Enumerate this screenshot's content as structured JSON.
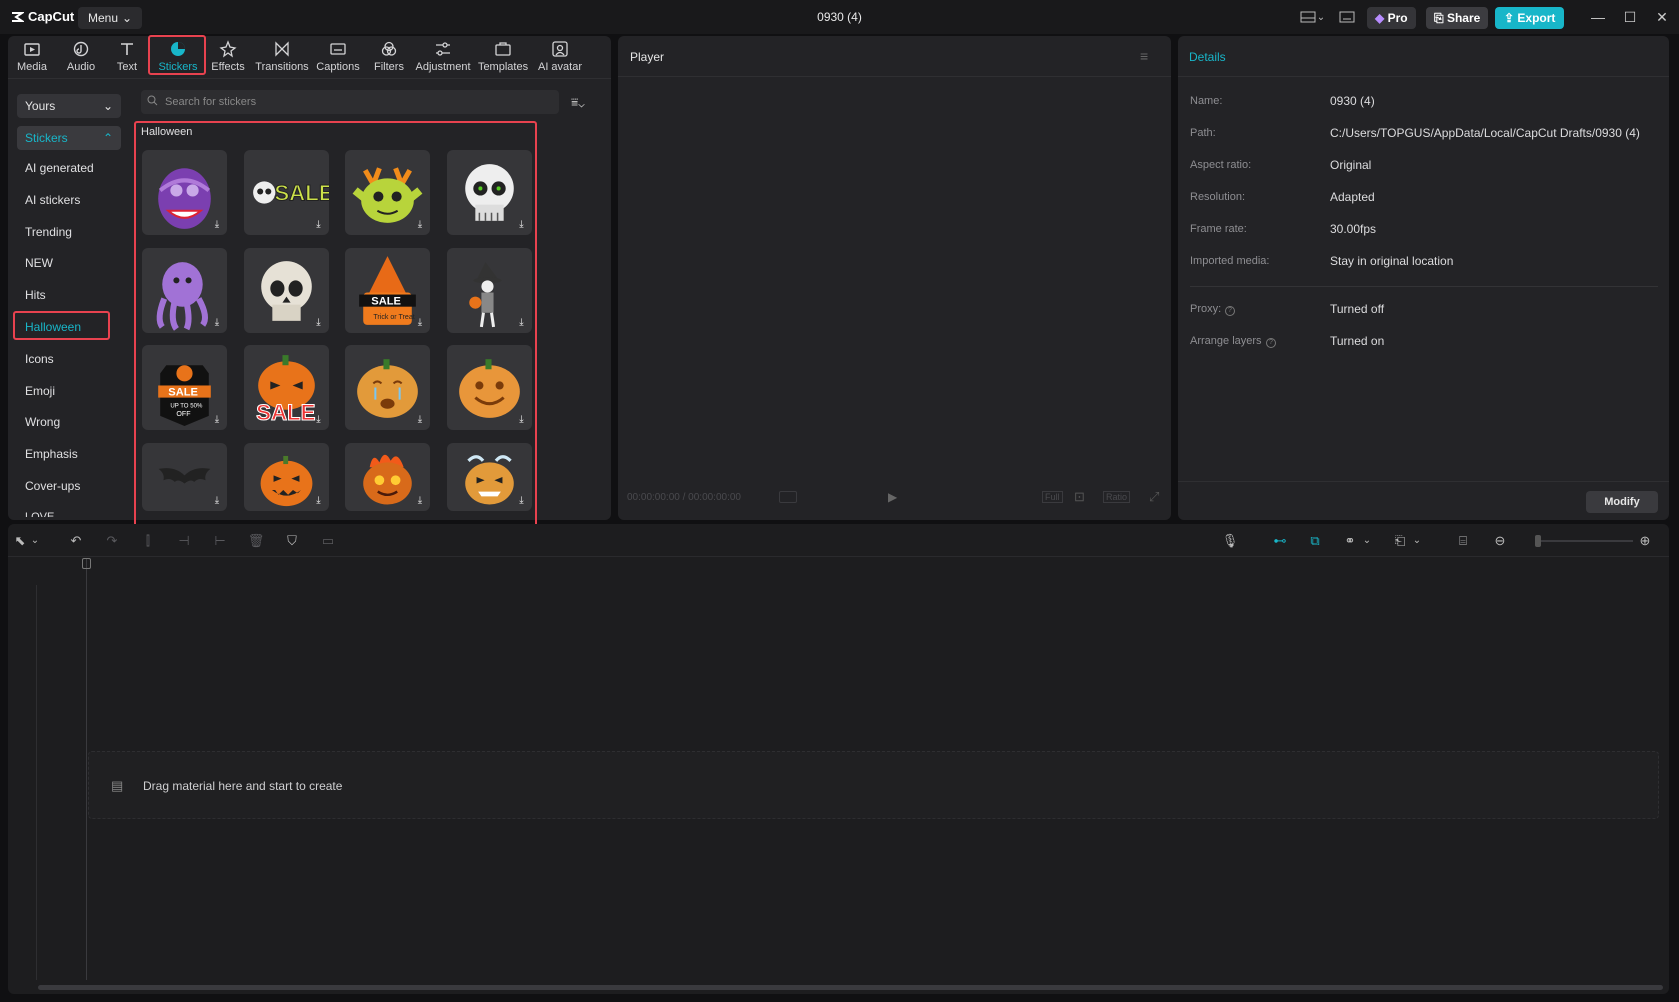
{
  "app": {
    "logo": "CapCut",
    "menu_label": "Menu",
    "window_title": "0930 (4)",
    "pro_label": "Pro",
    "share_label": "Share",
    "export_label": "Export"
  },
  "tabs": [
    {
      "label": "Media",
      "icon": "media-icon"
    },
    {
      "label": "Audio",
      "icon": "audio-icon"
    },
    {
      "label": "Text",
      "icon": "text-icon"
    },
    {
      "label": "Stickers",
      "icon": "stickers-icon",
      "active": true
    },
    {
      "label": "Effects",
      "icon": "effects-icon"
    },
    {
      "label": "Transitions",
      "icon": "transitions-icon"
    },
    {
      "label": "Captions",
      "icon": "captions-icon"
    },
    {
      "label": "Filters",
      "icon": "filters-icon"
    },
    {
      "label": "Adjustment",
      "icon": "adjustment-icon"
    },
    {
      "label": "Templates",
      "icon": "templates-icon"
    },
    {
      "label": "AI avatar",
      "icon": "ai-avatar-icon"
    }
  ],
  "sidebar": {
    "dropdown": "Yours",
    "category": "Stickers",
    "items": [
      "AI generated",
      "AI stickers",
      "Trending",
      "NEW",
      "Hits",
      "Halloween",
      "Icons",
      "Emoji",
      "Wrong",
      "Emphasis",
      "Cover-ups",
      "LOVE"
    ],
    "selected": "Halloween"
  },
  "search": {
    "placeholder": "Search for stickers"
  },
  "section_title": "Halloween",
  "stickers": [
    "purple-monster",
    "skull-sale",
    "green-goblin",
    "skull",
    "purple-octopus",
    "skull-2",
    "sale-witch-hat",
    "witch-skeleton",
    "happy-sale-badge",
    "pumpkin-sale",
    "pumpkin-crying",
    "pumpkin-smiling",
    "bat",
    "jack-o-lantern",
    "pumpkin-fire",
    "pumpkin-ice"
  ],
  "player": {
    "title": "Player",
    "timecode": "00:00:00:00 / 00:00:00:00",
    "full": "Full",
    "ratio": "Ratio"
  },
  "details": {
    "title": "Details",
    "rows": [
      {
        "label": "Name:",
        "value": "0930 (4)"
      },
      {
        "label": "Path:",
        "value": "C:/Users/TOPGUS/AppData/Local/CapCut Drafts/0930 (4)"
      },
      {
        "label": "Aspect ratio:",
        "value": "Original"
      },
      {
        "label": "Resolution:",
        "value": "Adapted"
      },
      {
        "label": "Frame rate:",
        "value": "30.00fps"
      },
      {
        "label": "Imported media:",
        "value": "Stay in original location"
      }
    ],
    "rows2": [
      {
        "label": "Proxy:",
        "value": "Turned off"
      },
      {
        "label": "Arrange layers",
        "value": "Turned on"
      }
    ],
    "modify_label": "Modify"
  },
  "timeline": {
    "drop_hint": "Drag material here and start to create"
  },
  "colors": {
    "accent": "#18b6c9",
    "highlight": "#e8424f"
  }
}
